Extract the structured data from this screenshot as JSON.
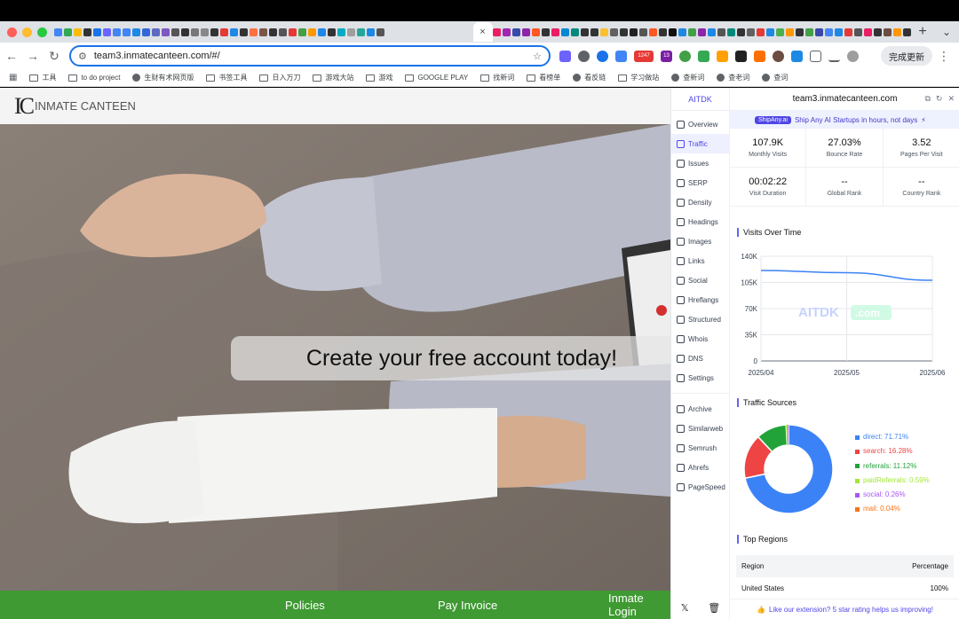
{
  "browser": {
    "tab_favicon_colors": [
      "#4285f4",
      "#34a853",
      "#fbbc05",
      "#333333",
      "#1a73e8",
      "#6c63ff",
      "#4285f4",
      "#4285f4",
      "#1e88e5",
      "#3367d6",
      "#5c6bc0",
      "#7e57c2",
      "#555555",
      "#333333",
      "#777777",
      "#888888",
      "#333333",
      "#e53935",
      "#1e88e5",
      "#333333",
      "#ff7043",
      "#795548",
      "#333333",
      "#555555",
      "#e53935",
      "#43a047",
      "#ff9800",
      "#1e88e5",
      "#333333",
      "#00acc1",
      "#9e9e9e",
      "#26a69a",
      "#1e88e5",
      "#555555"
    ],
    "tab_favicon_colors_right": [
      "#e91e63",
      "#9c27b0",
      "#3949ab",
      "#8e24aa",
      "#ff5722",
      "#333333",
      "#e91e63",
      "#0288d1",
      "#00897b",
      "#333333",
      "#333333",
      "#fbc02d",
      "#616161",
      "#333333",
      "#212121",
      "#555555",
      "#ff5722",
      "#333333",
      "#111111",
      "#1e88e5",
      "#43a047",
      "#8e24aa",
      "#1e88e5",
      "#555555",
      "#00897b",
      "#333333",
      "#616161",
      "#e53935",
      "#1e88e5",
      "#4caf50",
      "#ff9800",
      "#333333",
      "#43a047",
      "#3949ab",
      "#4285f4",
      "#1e88e5",
      "#e53935",
      "#555555",
      "#e91e63",
      "#333333",
      "#6d4c41",
      "#ff9800",
      "#333333",
      "#388e3c",
      "#1e88e5",
      "#8e24aa",
      "#333333",
      "#333333",
      "#d81b60",
      "#1976d2",
      "#333333",
      "#00bcd4",
      "#111111",
      "#ffb300",
      "#e91e63",
      "#4caf50",
      "#1e88e5",
      "#9c27b0",
      "#333333",
      "#e53935",
      "#1e88e5",
      "#7b1fa2"
    ],
    "active_tab_close": "×",
    "new_tab": "+",
    "tab_search": "⌄",
    "url": "team3.inmatecanteen.com/#/",
    "update_button": "完成更新",
    "ext_badge_1": "1247",
    "ext_badge_2": "13",
    "bookmarks": [
      {
        "label": "工具",
        "icon": "folder"
      },
      {
        "label": "to do project",
        "icon": "folder"
      },
      {
        "label": "生财有术网页版",
        "icon": "globe"
      },
      {
        "label": "书签工具",
        "icon": "folder"
      },
      {
        "label": "日入万刀",
        "icon": "folder"
      },
      {
        "label": "游戏大站",
        "icon": "folder"
      },
      {
        "label": "游戏",
        "icon": "folder"
      },
      {
        "label": "GOOGLE PLAY",
        "icon": "folder"
      },
      {
        "label": "找新词",
        "icon": "folder"
      },
      {
        "label": "看榜单",
        "icon": "folder"
      },
      {
        "label": "看反链",
        "icon": "globe"
      },
      {
        "label": "学习做站",
        "icon": "folder"
      },
      {
        "label": "查新词",
        "icon": "globe"
      },
      {
        "label": "查老词",
        "icon": "globe"
      },
      {
        "label": "查词",
        "icon": "globe"
      }
    ]
  },
  "site": {
    "logo_mark": "IC",
    "logo_text": "INMATE CANTEEN",
    "cta": "Create your free account today!",
    "footer_links": [
      "Policies",
      "Pay Invoice",
      "Inmate Login"
    ]
  },
  "panel": {
    "brand": "AITDK",
    "domain": "team3.inmatecanteen.com",
    "promo_badge": "ShipAny.ai",
    "promo_text": "Ship Any AI Startups in hours, not days",
    "nav": [
      "Overview",
      "Traffic",
      "Issues",
      "SERP",
      "Density",
      "Headings",
      "Images",
      "Links",
      "Social",
      "Hreflangs",
      "Structured",
      "Whois",
      "DNS",
      "Settings"
    ],
    "nav_tools": [
      "Archive",
      "Similarweb",
      "Semrush",
      "Ahrefs",
      "PageSpeed"
    ],
    "active_nav": "Traffic",
    "stats": [
      {
        "value": "107.9K",
        "label": "Monthly Visits"
      },
      {
        "value": "27.03%",
        "label": "Bounce Rate"
      },
      {
        "value": "3.52",
        "label": "Pages Per Visit"
      },
      {
        "value": "00:02:22",
        "label": "Visit Duration"
      },
      {
        "value": "--",
        "label": "Global Rank"
      },
      {
        "value": "--",
        "label": "Country Rank"
      }
    ],
    "visits_title": "Visits Over Time",
    "watermark": "AITDK",
    "watermark_suffix": ".com",
    "sources_title": "Traffic Sources",
    "regions_title": "Top Regions",
    "regions_header": [
      "Region",
      "Percentage"
    ],
    "regions": [
      {
        "region": "United States",
        "pct": "100%"
      }
    ],
    "bottom_note": "Like our extension? 5 star rating helps us improving!",
    "accent": "#4f46e5"
  },
  "chart_data": [
    {
      "type": "line",
      "x": [
        "2025/04",
        "2025/05",
        "2025/06"
      ],
      "series": [
        {
          "values": [
            121000,
            118000,
            107900
          ]
        }
      ],
      "ylim": [
        0,
        140000
      ],
      "yticks": [
        "0",
        "35K",
        "70K",
        "105K",
        "140K"
      ],
      "grid": true,
      "color": "#3b82f6"
    },
    {
      "type": "pie",
      "categories": [
        "direct",
        "search",
        "referrals",
        "paidReferrals",
        "social",
        "mail"
      ],
      "values": [
        71.71,
        16.28,
        11.12,
        0.59,
        0.26,
        0.04
      ],
      "labels": [
        "direct: 71.71%",
        "search: 16.28%",
        "referrals: 11.12%",
        "paidReferrals: 0.59%",
        "social: 0.26%",
        "mail: 0.04%"
      ],
      "colors": [
        "#3b82f6",
        "#ef4444",
        "#22a33a",
        "#a3e635",
        "#a855f7",
        "#f97316"
      ],
      "legend": "right"
    }
  ]
}
